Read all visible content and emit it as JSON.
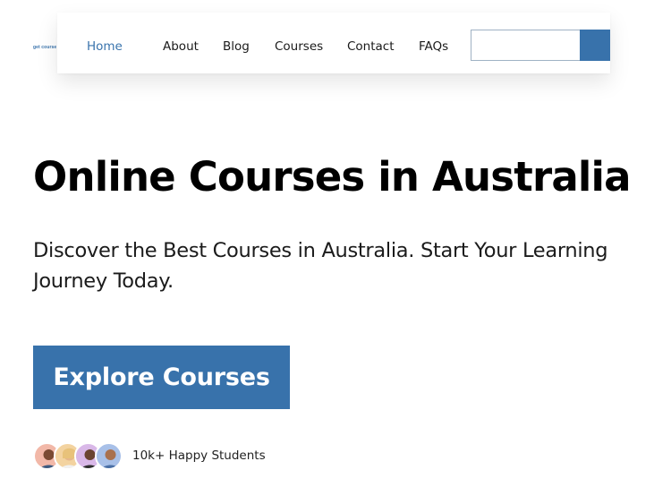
{
  "header": {
    "logo_text": "get course",
    "nav": [
      {
        "label": "Home",
        "active": true
      },
      {
        "label": "About",
        "active": false
      },
      {
        "label": "Blog",
        "active": false
      },
      {
        "label": "Courses",
        "active": false
      },
      {
        "label": "Contact",
        "active": false
      },
      {
        "label": "FAQs",
        "active": false
      }
    ],
    "search": {
      "value": "",
      "placeholder": ""
    }
  },
  "hero": {
    "title": "Online Courses in Australia",
    "subtitle": "Discover the Best Courses in Australia. Start Your Learning Journey Today.",
    "cta_label": "Explore Courses",
    "social_proof": "10k+ Happy Students"
  },
  "colors": {
    "accent": "#3872ab",
    "active_nav": "#3a74ad",
    "text": "#111111",
    "background": "#ffffff"
  },
  "avatars": [
    {
      "name": "avatar-1",
      "bg": "#f2b8a8"
    },
    {
      "name": "avatar-2",
      "bg": "#f3d3a0"
    },
    {
      "name": "avatar-3",
      "bg": "#d9b8e8"
    },
    {
      "name": "avatar-4",
      "bg": "#a8c0e8"
    }
  ]
}
